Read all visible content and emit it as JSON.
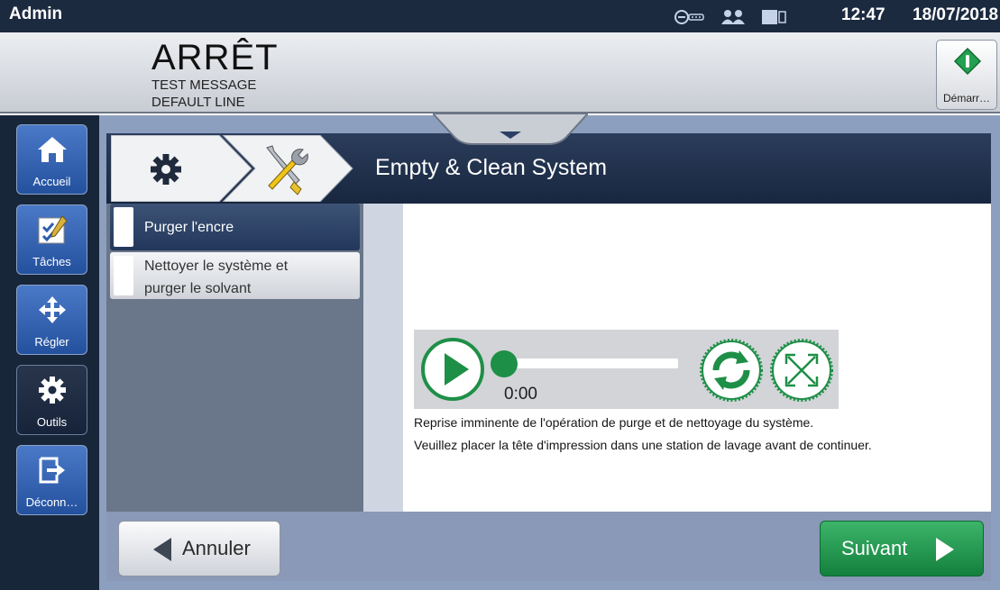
{
  "statusbar": {
    "user": "Admin",
    "time": "12:47",
    "date": "18/07/2018"
  },
  "header": {
    "state": "ARRÊT",
    "message": "TEST MESSAGE",
    "line": "DEFAULT LINE",
    "start_label": "Démarr…"
  },
  "nav": [
    {
      "label": "Accueil",
      "icon": "home-icon"
    },
    {
      "label": "Tâches",
      "icon": "tasks-icon"
    },
    {
      "label": "Régler",
      "icon": "move-icon"
    },
    {
      "label": "Outils",
      "icon": "gear-icon",
      "active": true
    },
    {
      "label": "Déconn…",
      "icon": "logout-icon"
    }
  ],
  "page": {
    "title": "Empty & Clean System"
  },
  "list": [
    {
      "label": "Purger l'encre",
      "selected": true
    },
    {
      "label_line1": "Nettoyer le système et",
      "label_line2": "purger le solvant"
    }
  ],
  "player": {
    "elapsed": "0:00",
    "progress": 0
  },
  "messages": [
    "Reprise imminente de l'opération de purge et de nettoyage du système.",
    "Veuillez placer la tête d'impression dans une station de lavage avant de continuer."
  ],
  "footer": {
    "cancel_label": "Annuler",
    "next_label": "Suivant"
  },
  "colors": {
    "accent_green": "#1e8f47",
    "nav_blue": "#2c5dab",
    "titlebar": "#1d2c46"
  }
}
